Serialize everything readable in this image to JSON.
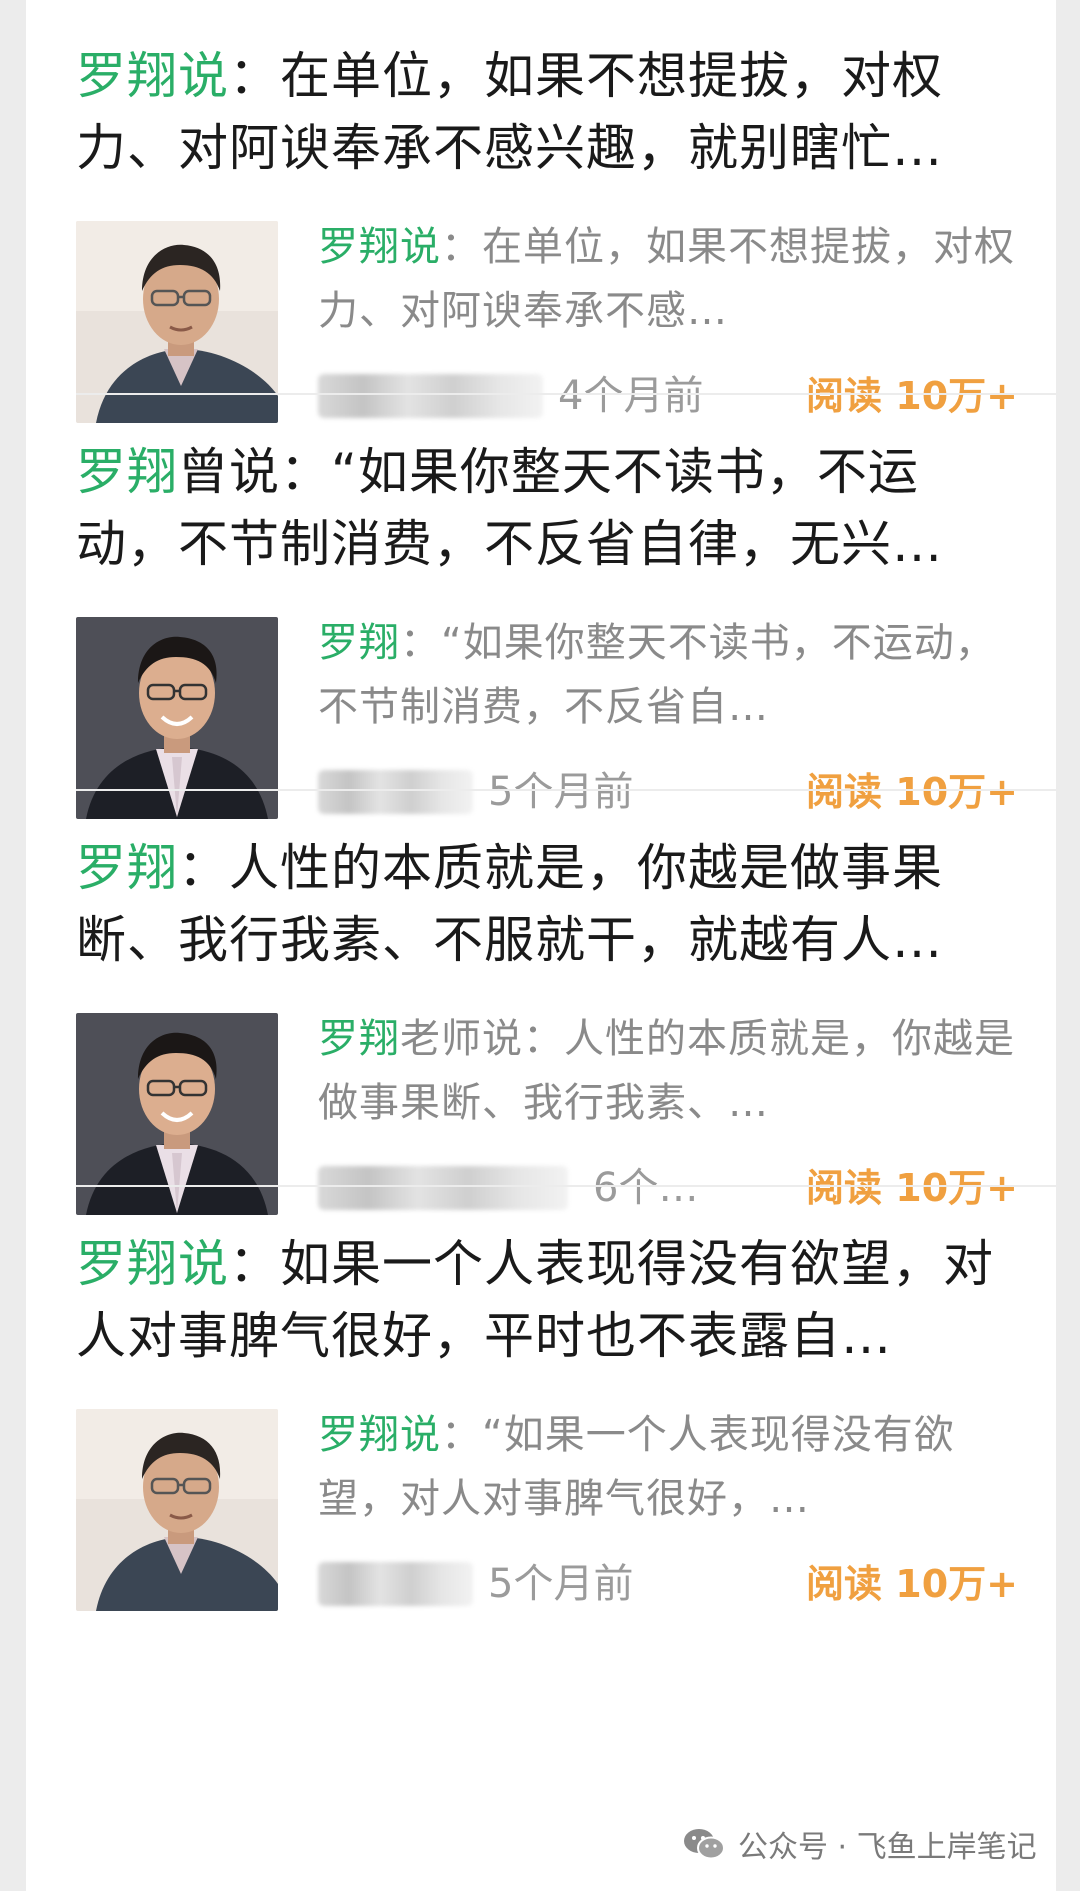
{
  "articles": [
    {
      "title_hl": "罗翔说",
      "title_rest": "：在单位，如果不想提拔，对权力、对阿谀奉承不感兴趣，就别瞎忙…",
      "summary_hl": "罗翔说",
      "summary_rest": "：在单位，如果不想提拔，对权力、对阿谀奉承不感…",
      "time": "4个月前",
      "reads": "阅读 10万+",
      "avatar": "person-casual-icon"
    },
    {
      "title_hl": "罗翔",
      "title_rest": "曾说：“如果你整天不读书，不运动，不节制消费，不反省自律，无兴…",
      "summary_hl": "罗翔",
      "summary_rest": "：“如果你整天不读书，不运动，不节制消费，不反省自…",
      "time": "5个月前",
      "reads": "阅读 10万+",
      "avatar": "person-suit-icon"
    },
    {
      "title_hl": "罗翔",
      "title_rest": "：人性的本质就是，你越是做事果断、我行我素、不服就干，就越有人…",
      "summary_hl": "罗翔",
      "summary_rest": "老师说：人性的本质就是，你越是做事果断、我行我素、…",
      "time": "6个…",
      "reads": "阅读 10万+",
      "avatar": "person-suit-icon"
    },
    {
      "title_hl": "罗翔说",
      "title_rest": "：如果一个人表现得没有欲望，对人对事脾气很好，平时也不表露自…",
      "summary_hl": "罗翔说",
      "summary_rest": "：“如果一个人表现得没有欲望，对人对事脾气很好，…",
      "time": "5个月前",
      "reads": "阅读 10万+",
      "avatar": "person-casual-icon"
    }
  ],
  "watermark": {
    "icon": "wechat-icon",
    "label": "公众号 · 飞鱼上岸笔记"
  },
  "colors": {
    "highlight": "#2aae67",
    "reads": "#f0a040",
    "meta": "#9b9b9b"
  }
}
